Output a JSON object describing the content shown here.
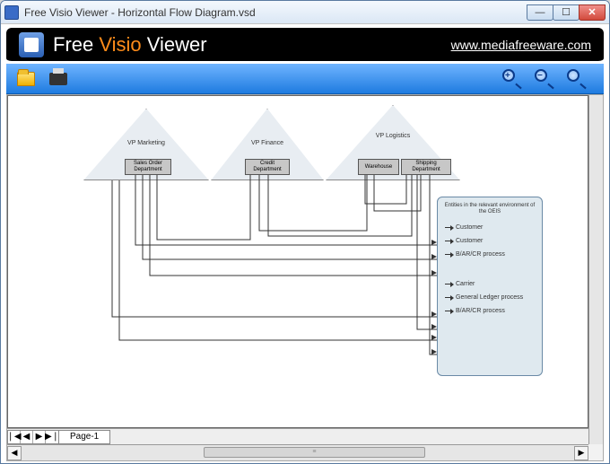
{
  "window": {
    "title": "Free Visio Viewer  -  Horizontal Flow Diagram.vsd",
    "buttons": {
      "min": "—",
      "max": "☐",
      "close": "✕"
    }
  },
  "brand": {
    "pre": "Free ",
    "accent": "Visio",
    "post": " Viewer",
    "url": "www.mediafreeware.com"
  },
  "toolbar": {
    "open": "Open",
    "print": "Print",
    "zoom_in": "+",
    "zoom_out": "−",
    "zoom_fit": " "
  },
  "diagram": {
    "pyramids": [
      {
        "title": "VP\nMarketing",
        "boxes": [
          "Sales Order Department"
        ]
      },
      {
        "title": "VP\nFinance",
        "boxes": [
          "Credit Department"
        ]
      },
      {
        "title": "VP\nLogistics",
        "boxes": [
          "Warehouse",
          "Shipping Department"
        ]
      }
    ],
    "entities": {
      "header": "Entities in the relevant environment of the OEIS",
      "items": [
        "Customer",
        "Customer",
        "B/AR/CR process",
        "Carrier",
        "General Ledger process",
        "B/AR/CR process"
      ]
    }
  },
  "pager": {
    "first": "❘◀",
    "prev": "◀",
    "next": "▶",
    "last": "▶❘",
    "tab": "Page-1",
    "scroll_left": "◀",
    "scroll_right": "▶"
  }
}
